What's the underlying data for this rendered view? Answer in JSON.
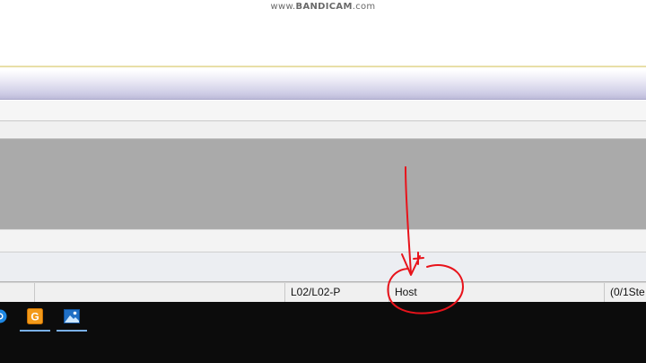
{
  "watermark": {
    "brand": "BANDICAM",
    "prefix": "www.",
    "suffix": ".com"
  },
  "status_bar": {
    "cells": [
      {
        "text": ""
      },
      {
        "text": ""
      },
      {
        "text": "L02/L02-P"
      },
      {
        "text": "Host"
      },
      {
        "text": "(0/1Ste"
      }
    ]
  },
  "taskbar": {
    "items": [
      {
        "icon": "browser-icon"
      },
      {
        "icon": "orange-app-icon",
        "label": "G"
      },
      {
        "icon": "photos-icon"
      }
    ]
  },
  "colors": {
    "annotation_red": "#e8131b",
    "taskbar": "#0c0c0c",
    "gray_area": "#aaaaaa"
  }
}
